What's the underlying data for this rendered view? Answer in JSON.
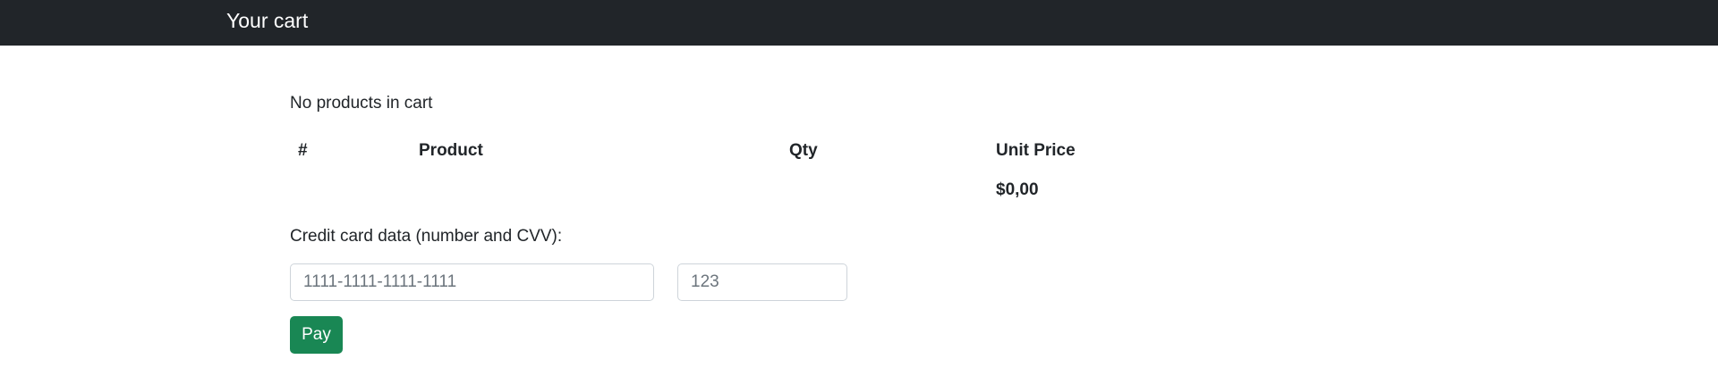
{
  "navbar": {
    "title": "Your cart"
  },
  "cart": {
    "empty_message": "No products in cart",
    "columns": [
      "#",
      "Product",
      "Qty",
      "Unit Price"
    ],
    "total": "$0,00"
  },
  "payment": {
    "label": "Credit card data (number and CVV):",
    "card_number_placeholder": "1111-1111-1111-1111",
    "cvv_placeholder": "123",
    "pay_label": "Pay"
  },
  "colors": {
    "navbar": "#212529",
    "pay_button": "#198754"
  }
}
